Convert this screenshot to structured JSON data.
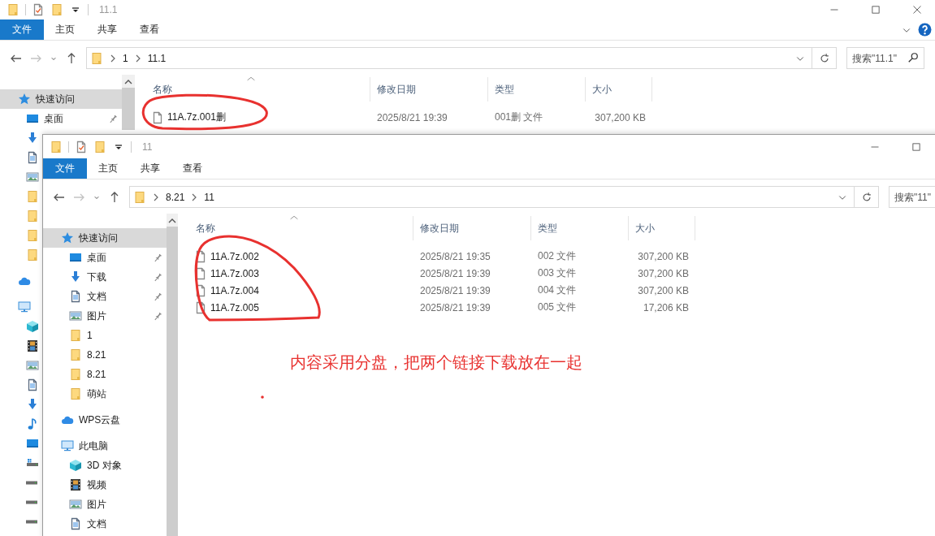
{
  "windows": [
    {
      "title": "11.1",
      "title_buttons": [
        {
          "kind": "minimize"
        },
        {
          "kind": "maximize"
        },
        {
          "kind": "close"
        }
      ],
      "ribbon_tabs": [
        {
          "kind": "menu",
          "label": "文件"
        },
        {
          "kind": "tab",
          "label": "主页"
        },
        {
          "kind": "tab",
          "label": "共享"
        },
        {
          "kind": "tab",
          "label": "查看"
        }
      ],
      "help_button": true,
      "nav_buttons": [
        {
          "kind": "back",
          "disabled": false
        },
        {
          "kind": "forward",
          "disabled": true
        },
        {
          "kind": "recent",
          "disabled": false
        },
        {
          "kind": "up",
          "disabled": false
        }
      ],
      "path": [
        "1",
        "11.1"
      ],
      "search": {
        "placeholder": "搜索\"11.1\""
      },
      "sidebar": [
        {
          "kind": "star",
          "label": "快速访问",
          "selected": true,
          "children": [
            {
              "kind": "desktop",
              "label": "桌面",
              "pinned": true
            },
            {
              "kind": "download"
            },
            {
              "kind": "document"
            },
            {
              "kind": "picture"
            },
            {
              "kind": "folder"
            },
            {
              "kind": "folder"
            },
            {
              "kind": "folder"
            },
            {
              "kind": "folder"
            }
          ]
        },
        {
          "kind": "cloud",
          "selected": false
        },
        {
          "kind": "pc",
          "selected": false,
          "children": [
            {
              "kind": "cube"
            },
            {
              "kind": "video"
            },
            {
              "kind": "picture"
            },
            {
              "kind": "document"
            },
            {
              "kind": "download"
            },
            {
              "kind": "music"
            },
            {
              "kind": "desktop"
            },
            {
              "kind": "windrive"
            },
            {
              "kind": "drive"
            },
            {
              "kind": "drive"
            },
            {
              "kind": "drive"
            }
          ]
        }
      ],
      "columns": [
        "名称",
        "修改日期",
        "类型",
        "大小"
      ],
      "files": [
        {
          "name": "11A.7z.001删",
          "modified": "2025/8/21 19:39",
          "type": "001删 文件",
          "size": "307,200 KB"
        }
      ]
    },
    {
      "title": "11",
      "title_buttons": [
        {
          "kind": "minimize"
        },
        {
          "kind": "maximize"
        }
      ],
      "ribbon_tabs": [
        {
          "kind": "menu",
          "label": "文件"
        },
        {
          "kind": "tab",
          "label": "主页"
        },
        {
          "kind": "tab",
          "label": "共享"
        },
        {
          "kind": "tab",
          "label": "查看"
        }
      ],
      "nav_buttons": [
        {
          "kind": "back",
          "disabled": false
        },
        {
          "kind": "forward",
          "disabled": true
        },
        {
          "kind": "recent",
          "disabled": false
        },
        {
          "kind": "up",
          "disabled": false
        }
      ],
      "path": [
        "8.21",
        "11"
      ],
      "search": {
        "placeholder": "搜索\"11\""
      },
      "sidebar": [
        {
          "kind": "star",
          "label": "快速访问",
          "selected": true,
          "children": [
            {
              "kind": "desktop",
              "label": "桌面",
              "pinned": true
            },
            {
              "kind": "download",
              "label": "下载",
              "pinned": true
            },
            {
              "kind": "document",
              "label": "文档",
              "pinned": true
            },
            {
              "kind": "picture",
              "label": "图片",
              "pinned": true
            },
            {
              "kind": "folder",
              "label": "1",
              "pinned": false
            },
            {
              "kind": "folder",
              "label": "8.21",
              "pinned": false
            },
            {
              "kind": "folder",
              "label": "8.21",
              "pinned": false
            },
            {
              "kind": "folder",
              "label": "萌站",
              "pinned": false
            }
          ]
        },
        {
          "kind": "cloud",
          "label": "WPS云盘",
          "selected": false
        },
        {
          "kind": "pc",
          "label": "此电脑",
          "selected": false,
          "children": [
            {
              "kind": "cube",
              "label": "3D 对象"
            },
            {
              "kind": "video",
              "label": "视频"
            },
            {
              "kind": "picture",
              "label": "图片"
            },
            {
              "kind": "document",
              "label": "文档"
            }
          ]
        }
      ],
      "columns": [
        "名称",
        "修改日期",
        "类型",
        "大小"
      ],
      "files": [
        {
          "name": "11A.7z.002",
          "modified": "2025/8/21 19:35",
          "type": "002 文件",
          "size": "307,200 KB"
        },
        {
          "name": "11A.7z.003",
          "modified": "2025/8/21 19:39",
          "type": "003 文件",
          "size": "307,200 KB"
        },
        {
          "name": "11A.7z.004",
          "modified": "2025/8/21 19:39",
          "type": "004 文件",
          "size": "307,200 KB"
        },
        {
          "name": "11A.7z.005",
          "modified": "2025/8/21 19:39",
          "type": "005 文件",
          "size": "17,206 KB"
        }
      ]
    }
  ],
  "annotation": {
    "text": "内容采用分盘，把两个链接下载放在一起"
  }
}
